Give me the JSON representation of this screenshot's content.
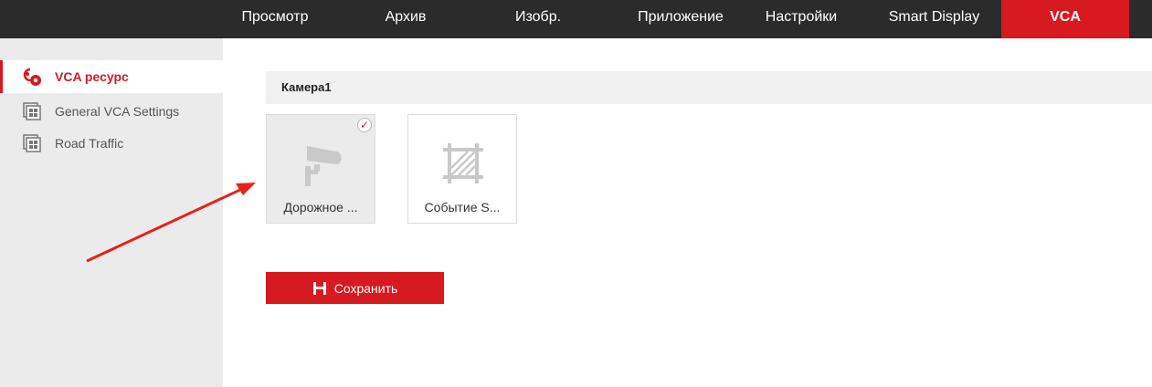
{
  "nav": [
    "Просмотр",
    "Архив",
    "Изобр.",
    "Приложение",
    "Настройки",
    "Smart Display",
    "VCA"
  ],
  "sidebar": [
    {
      "label": "VCA ресурс",
      "icon": "vca-resource-icon"
    },
    {
      "label": "General VCA Settings",
      "icon": "grid-icon"
    },
    {
      "label": "Road Traffic",
      "icon": "grid-icon"
    }
  ],
  "camera": "Камера1",
  "cards": [
    {
      "label": "Дорожное ...",
      "selected": true,
      "icon": "camera-icon"
    },
    {
      "label": "Событие S...",
      "selected": false,
      "icon": "region-icon"
    }
  ],
  "check": "✓",
  "save": "Сохранить",
  "colors": {
    "accent": "#d71920",
    "topbar": "#2b2b2b"
  }
}
